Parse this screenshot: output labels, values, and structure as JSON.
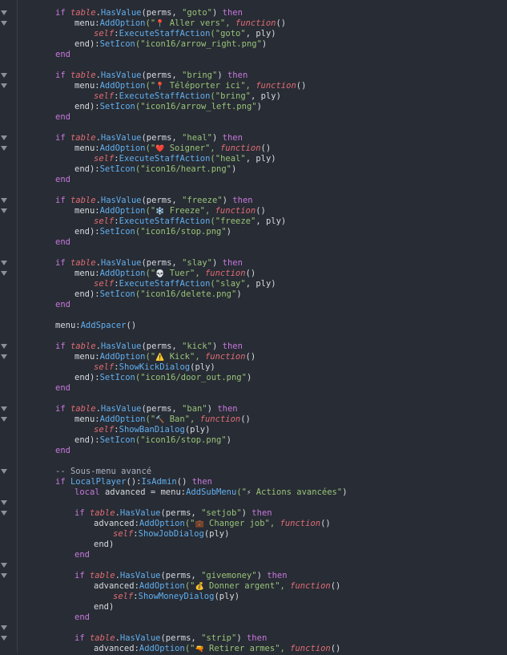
{
  "editor": {
    "language": "lua",
    "colors": {
      "background": "#282c34",
      "keyword": "#c678dd",
      "italic": "#e06c75",
      "function": "#61afef",
      "string": "#98c379",
      "plain": "#d7dae0"
    },
    "lines": [
      [
        [
          "kw",
          "if "
        ],
        [
          "it",
          "table"
        ],
        [
          "pl",
          "."
        ],
        [
          "fn",
          "HasValue"
        ],
        [
          "pl",
          "(perms, "
        ],
        [
          "str",
          "\"goto\""
        ],
        [
          "pl",
          ") "
        ],
        [
          "kw",
          "then"
        ]
      ],
      [
        [
          "pl",
          "menu:"
        ],
        [
          "fn",
          "AddOption"
        ],
        [
          "str",
          "(\""
        ],
        [
          "emo",
          "📍"
        ],
        [
          "str",
          " Aller vers\", "
        ],
        [
          "it",
          "function"
        ],
        [
          "pl",
          "()"
        ]
      ],
      [
        [
          "it",
          "self"
        ],
        [
          "pl",
          ":"
        ],
        [
          "fn",
          "ExecuteStaffAction"
        ],
        [
          "str",
          "(\"goto\""
        ],
        [
          "pl",
          ", ply)"
        ]
      ],
      [
        [
          "pl",
          "end):"
        ],
        [
          "fn",
          "SetIcon"
        ],
        [
          "str",
          "(\"icon16/arrow_right.png\""
        ],
        [
          "pl",
          ")"
        ]
      ],
      [
        [
          "kw",
          "end"
        ]
      ],
      [],
      [
        [
          "kw",
          "if "
        ],
        [
          "it",
          "table"
        ],
        [
          "pl",
          "."
        ],
        [
          "fn",
          "HasValue"
        ],
        [
          "pl",
          "(perms, "
        ],
        [
          "str",
          "\"bring\""
        ],
        [
          "pl",
          ") "
        ],
        [
          "kw",
          "then"
        ]
      ],
      [
        [
          "pl",
          "menu:"
        ],
        [
          "fn",
          "AddOption"
        ],
        [
          "str",
          "(\""
        ],
        [
          "emo",
          "📍"
        ],
        [
          "str",
          " Téléporter ici\", "
        ],
        [
          "it",
          "function"
        ],
        [
          "pl",
          "()"
        ]
      ],
      [
        [
          "it",
          "self"
        ],
        [
          "pl",
          ":"
        ],
        [
          "fn",
          "ExecuteStaffAction"
        ],
        [
          "str",
          "(\"bring\""
        ],
        [
          "pl",
          ", ply)"
        ]
      ],
      [
        [
          "pl",
          "end):"
        ],
        [
          "fn",
          "SetIcon"
        ],
        [
          "str",
          "(\"icon16/arrow_left.png\""
        ],
        [
          "pl",
          ")"
        ]
      ],
      [
        [
          "kw",
          "end"
        ]
      ],
      [],
      [
        [
          "kw",
          "if "
        ],
        [
          "it",
          "table"
        ],
        [
          "pl",
          "."
        ],
        [
          "fn",
          "HasValue"
        ],
        [
          "pl",
          "(perms, "
        ],
        [
          "str",
          "\"heal\""
        ],
        [
          "pl",
          ") "
        ],
        [
          "kw",
          "then"
        ]
      ],
      [
        [
          "pl",
          "menu:"
        ],
        [
          "fn",
          "AddOption"
        ],
        [
          "str",
          "(\""
        ],
        [
          "emo",
          "❤️"
        ],
        [
          "str",
          " Soigner\", "
        ],
        [
          "it",
          "function"
        ],
        [
          "pl",
          "()"
        ]
      ],
      [
        [
          "it",
          "self"
        ],
        [
          "pl",
          ":"
        ],
        [
          "fn",
          "ExecuteStaffAction"
        ],
        [
          "str",
          "(\"heal\""
        ],
        [
          "pl",
          ", ply)"
        ]
      ],
      [
        [
          "pl",
          "end):"
        ],
        [
          "fn",
          "SetIcon"
        ],
        [
          "str",
          "(\"icon16/heart.png\""
        ],
        [
          "pl",
          ")"
        ]
      ],
      [
        [
          "kw",
          "end"
        ]
      ],
      [],
      [
        [
          "kw",
          "if "
        ],
        [
          "it",
          "table"
        ],
        [
          "pl",
          "."
        ],
        [
          "fn",
          "HasValue"
        ],
        [
          "pl",
          "(perms, "
        ],
        [
          "str",
          "\"freeze\""
        ],
        [
          "pl",
          ") "
        ],
        [
          "kw",
          "then"
        ]
      ],
      [
        [
          "pl",
          "menu:"
        ],
        [
          "fn",
          "AddOption"
        ],
        [
          "str",
          "(\""
        ],
        [
          "emo",
          "❄️"
        ],
        [
          "str",
          " Freeze\", "
        ],
        [
          "it",
          "function"
        ],
        [
          "pl",
          "()"
        ]
      ],
      [
        [
          "it",
          "self"
        ],
        [
          "pl",
          ":"
        ],
        [
          "fn",
          "ExecuteStaffAction"
        ],
        [
          "str",
          "(\"freeze\""
        ],
        [
          "pl",
          ", ply)"
        ]
      ],
      [
        [
          "pl",
          "end):"
        ],
        [
          "fn",
          "SetIcon"
        ],
        [
          "str",
          "(\"icon16/stop.png\""
        ],
        [
          "pl",
          ")"
        ]
      ],
      [
        [
          "kw",
          "end"
        ]
      ],
      [],
      [
        [
          "kw",
          "if "
        ],
        [
          "it",
          "table"
        ],
        [
          "pl",
          "."
        ],
        [
          "fn",
          "HasValue"
        ],
        [
          "pl",
          "(perms, "
        ],
        [
          "str",
          "\"slay\""
        ],
        [
          "pl",
          ") "
        ],
        [
          "kw",
          "then"
        ]
      ],
      [
        [
          "pl",
          "menu:"
        ],
        [
          "fn",
          "AddOption"
        ],
        [
          "str",
          "(\""
        ],
        [
          "emo",
          "💀"
        ],
        [
          "str",
          " Tuer\", "
        ],
        [
          "it",
          "function"
        ],
        [
          "pl",
          "()"
        ]
      ],
      [
        [
          "it",
          "self"
        ],
        [
          "pl",
          ":"
        ],
        [
          "fn",
          "ExecuteStaffAction"
        ],
        [
          "str",
          "(\"slay\""
        ],
        [
          "pl",
          ", ply)"
        ]
      ],
      [
        [
          "pl",
          "end):"
        ],
        [
          "fn",
          "SetIcon"
        ],
        [
          "str",
          "(\"icon16/delete.png\""
        ],
        [
          "pl",
          ")"
        ]
      ],
      [
        [
          "kw",
          "end"
        ]
      ],
      [],
      [
        [
          "pl",
          "menu:"
        ],
        [
          "fn",
          "AddSpacer"
        ],
        [
          "pl",
          "()"
        ]
      ],
      [],
      [
        [
          "kw",
          "if "
        ],
        [
          "it",
          "table"
        ],
        [
          "pl",
          "."
        ],
        [
          "fn",
          "HasValue"
        ],
        [
          "pl",
          "(perms, "
        ],
        [
          "str",
          "\"kick\""
        ],
        [
          "pl",
          ") "
        ],
        [
          "kw",
          "then"
        ]
      ],
      [
        [
          "pl",
          "menu:"
        ],
        [
          "fn",
          "AddOption"
        ],
        [
          "str",
          "(\""
        ],
        [
          "emo",
          "⚠️"
        ],
        [
          "str",
          " Kick\", "
        ],
        [
          "it",
          "function"
        ],
        [
          "pl",
          "()"
        ]
      ],
      [
        [
          "it",
          "self"
        ],
        [
          "pl",
          ":"
        ],
        [
          "fn",
          "ShowKickDialog"
        ],
        [
          "pl",
          "(ply)"
        ]
      ],
      [
        [
          "pl",
          "end):"
        ],
        [
          "fn",
          "SetIcon"
        ],
        [
          "str",
          "(\"icon16/door_out.png\""
        ],
        [
          "pl",
          ")"
        ]
      ],
      [
        [
          "kw",
          "end"
        ]
      ],
      [],
      [
        [
          "kw",
          "if "
        ],
        [
          "it",
          "table"
        ],
        [
          "pl",
          "."
        ],
        [
          "fn",
          "HasValue"
        ],
        [
          "pl",
          "(perms, "
        ],
        [
          "str",
          "\"ban\""
        ],
        [
          "pl",
          ") "
        ],
        [
          "kw",
          "then"
        ]
      ],
      [
        [
          "pl",
          "menu:"
        ],
        [
          "fn",
          "AddOption"
        ],
        [
          "str",
          "(\""
        ],
        [
          "emo",
          "🔨"
        ],
        [
          "str",
          " Ban\", "
        ],
        [
          "it",
          "function"
        ],
        [
          "pl",
          "()"
        ]
      ],
      [
        [
          "it",
          "self"
        ],
        [
          "pl",
          ":"
        ],
        [
          "fn",
          "ShowBanDialog"
        ],
        [
          "pl",
          "(ply)"
        ]
      ],
      [
        [
          "pl",
          "end):"
        ],
        [
          "fn",
          "SetIcon"
        ],
        [
          "str",
          "(\"icon16/stop.png\""
        ],
        [
          "pl",
          ")"
        ]
      ],
      [
        [
          "kw",
          "end"
        ]
      ],
      [],
      [
        [
          "cm",
          "-- Sous-menu avancé"
        ]
      ],
      [
        [
          "kw",
          "if "
        ],
        [
          "fn",
          "LocalPlayer"
        ],
        [
          "pl",
          "():"
        ],
        [
          "fn",
          "IsAdmin"
        ],
        [
          "pl",
          "() "
        ],
        [
          "kw",
          "then"
        ]
      ],
      [
        [
          "kw",
          "local "
        ],
        [
          "pl",
          "advanced = menu:"
        ],
        [
          "fn",
          "AddSubMenu"
        ],
        [
          "str",
          "(\""
        ],
        [
          "emo",
          "⚡"
        ],
        [
          "str",
          " Actions avancées\""
        ],
        [
          "pl",
          ")"
        ]
      ],
      [],
      [
        [
          "kw",
          "if "
        ],
        [
          "it",
          "table"
        ],
        [
          "pl",
          "."
        ],
        [
          "fn",
          "HasValue"
        ],
        [
          "pl",
          "(perms, "
        ],
        [
          "str",
          "\"setjob\""
        ],
        [
          "pl",
          ") "
        ],
        [
          "kw",
          "then"
        ]
      ],
      [
        [
          "pl",
          "advanced:"
        ],
        [
          "fn",
          "AddOption"
        ],
        [
          "str",
          "(\""
        ],
        [
          "emo",
          "💼"
        ],
        [
          "str",
          " Changer job\", "
        ],
        [
          "it",
          "function"
        ],
        [
          "pl",
          "()"
        ]
      ],
      [
        [
          "it",
          "self"
        ],
        [
          "pl",
          ":"
        ],
        [
          "fn",
          "ShowJobDialog"
        ],
        [
          "pl",
          "(ply)"
        ]
      ],
      [
        [
          "pl",
          "end)"
        ]
      ],
      [
        [
          "kw",
          "end"
        ]
      ],
      [],
      [
        [
          "kw",
          "if "
        ],
        [
          "it",
          "table"
        ],
        [
          "pl",
          "."
        ],
        [
          "fn",
          "HasValue"
        ],
        [
          "pl",
          "(perms, "
        ],
        [
          "str",
          "\"givemoney\""
        ],
        [
          "pl",
          ") "
        ],
        [
          "kw",
          "then"
        ]
      ],
      [
        [
          "pl",
          "advanced:"
        ],
        [
          "fn",
          "AddOption"
        ],
        [
          "str",
          "(\""
        ],
        [
          "emo",
          "💰"
        ],
        [
          "str",
          " Donner argent\", "
        ],
        [
          "it",
          "function"
        ],
        [
          "pl",
          "()"
        ]
      ],
      [
        [
          "it",
          "self"
        ],
        [
          "pl",
          ":"
        ],
        [
          "fn",
          "ShowMoneyDialog"
        ],
        [
          "pl",
          "(ply)"
        ]
      ],
      [
        [
          "pl",
          "end)"
        ]
      ],
      [
        [
          "kw",
          "end"
        ]
      ],
      [],
      [
        [
          "kw",
          "if "
        ],
        [
          "it",
          "table"
        ],
        [
          "pl",
          "."
        ],
        [
          "fn",
          "HasValue"
        ],
        [
          "pl",
          "(perms, "
        ],
        [
          "str",
          "\"strip\""
        ],
        [
          "pl",
          ") "
        ],
        [
          "kw",
          "then"
        ]
      ],
      [
        [
          "pl",
          "advanced:"
        ],
        [
          "fn",
          "AddOption"
        ],
        [
          "str",
          "(\""
        ],
        [
          "emo",
          "🔫"
        ],
        [
          "str",
          " Retirer armes\", "
        ],
        [
          "it",
          "function"
        ],
        [
          "pl",
          "()"
        ]
      ]
    ]
  }
}
